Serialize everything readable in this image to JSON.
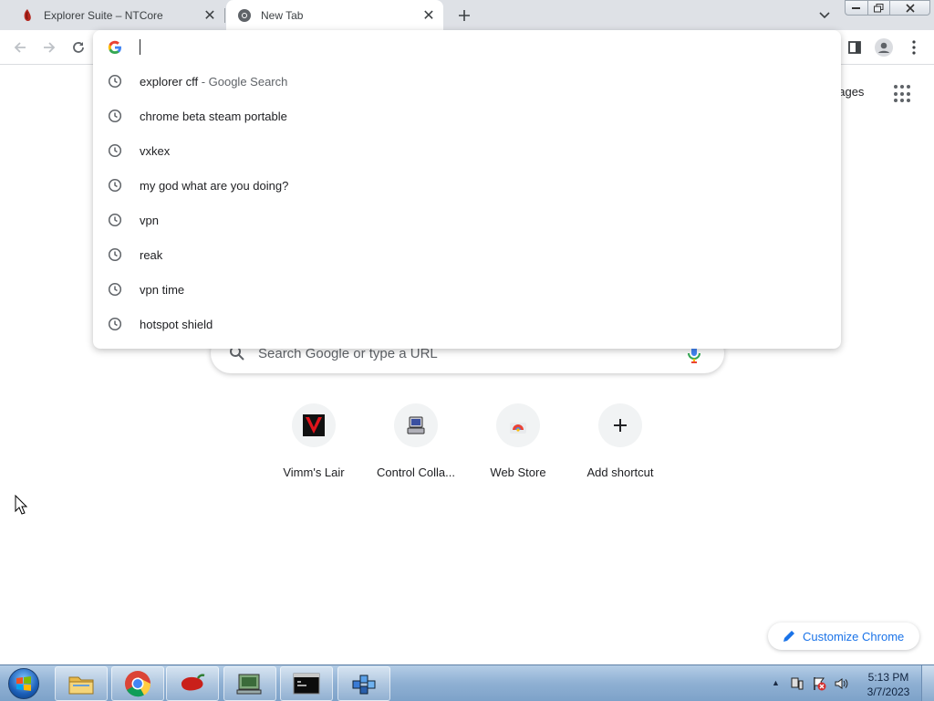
{
  "tabs": [
    {
      "title": "Explorer Suite – NTCore",
      "active": false
    },
    {
      "title": "New Tab",
      "active": true
    }
  ],
  "omnibox": {
    "value": "",
    "suggestions": [
      {
        "text": "explorer cff",
        "suffix": " - Google Search",
        "icon": "clock-icon"
      },
      {
        "text": "chrome beta steam portable",
        "suffix": "",
        "icon": "clock-icon"
      },
      {
        "text": "vxkex",
        "suffix": "",
        "icon": "clock-icon"
      },
      {
        "text": "my god what are you doing?",
        "suffix": "",
        "icon": "clock-icon"
      },
      {
        "text": "vpn",
        "suffix": "",
        "icon": "clock-icon"
      },
      {
        "text": "reak",
        "suffix": "",
        "icon": "clock-icon"
      },
      {
        "text": "vpn time",
        "suffix": "",
        "icon": "clock-icon"
      },
      {
        "text": "hotspot shield",
        "suffix": "",
        "icon": "clock-icon"
      }
    ]
  },
  "ntp": {
    "images_link": "nages",
    "search_placeholder": "Search Google or type a URL",
    "shortcuts": [
      {
        "label": "Vimm's Lair",
        "icon": "vimms-lair-icon"
      },
      {
        "label": "Control Colla...",
        "icon": "control-collab-icon"
      },
      {
        "label": "Web Store",
        "icon": "web-store-icon"
      },
      {
        "label": "Add shortcut",
        "icon": "plus-icon"
      }
    ],
    "customize_label": "Customize Chrome"
  },
  "taskbar": {
    "apps": [
      "file-explorer-icon",
      "chrome-icon",
      "pepper-app-icon",
      "network-app-icon",
      "command-prompt-icon",
      "registry-app-icon"
    ],
    "time": "5:13 PM",
    "date": "3/7/2023"
  },
  "colors": {
    "accent": "#1a73e8",
    "tabstrip": "#dee1e6",
    "taskbar": "#8fb0d3"
  }
}
